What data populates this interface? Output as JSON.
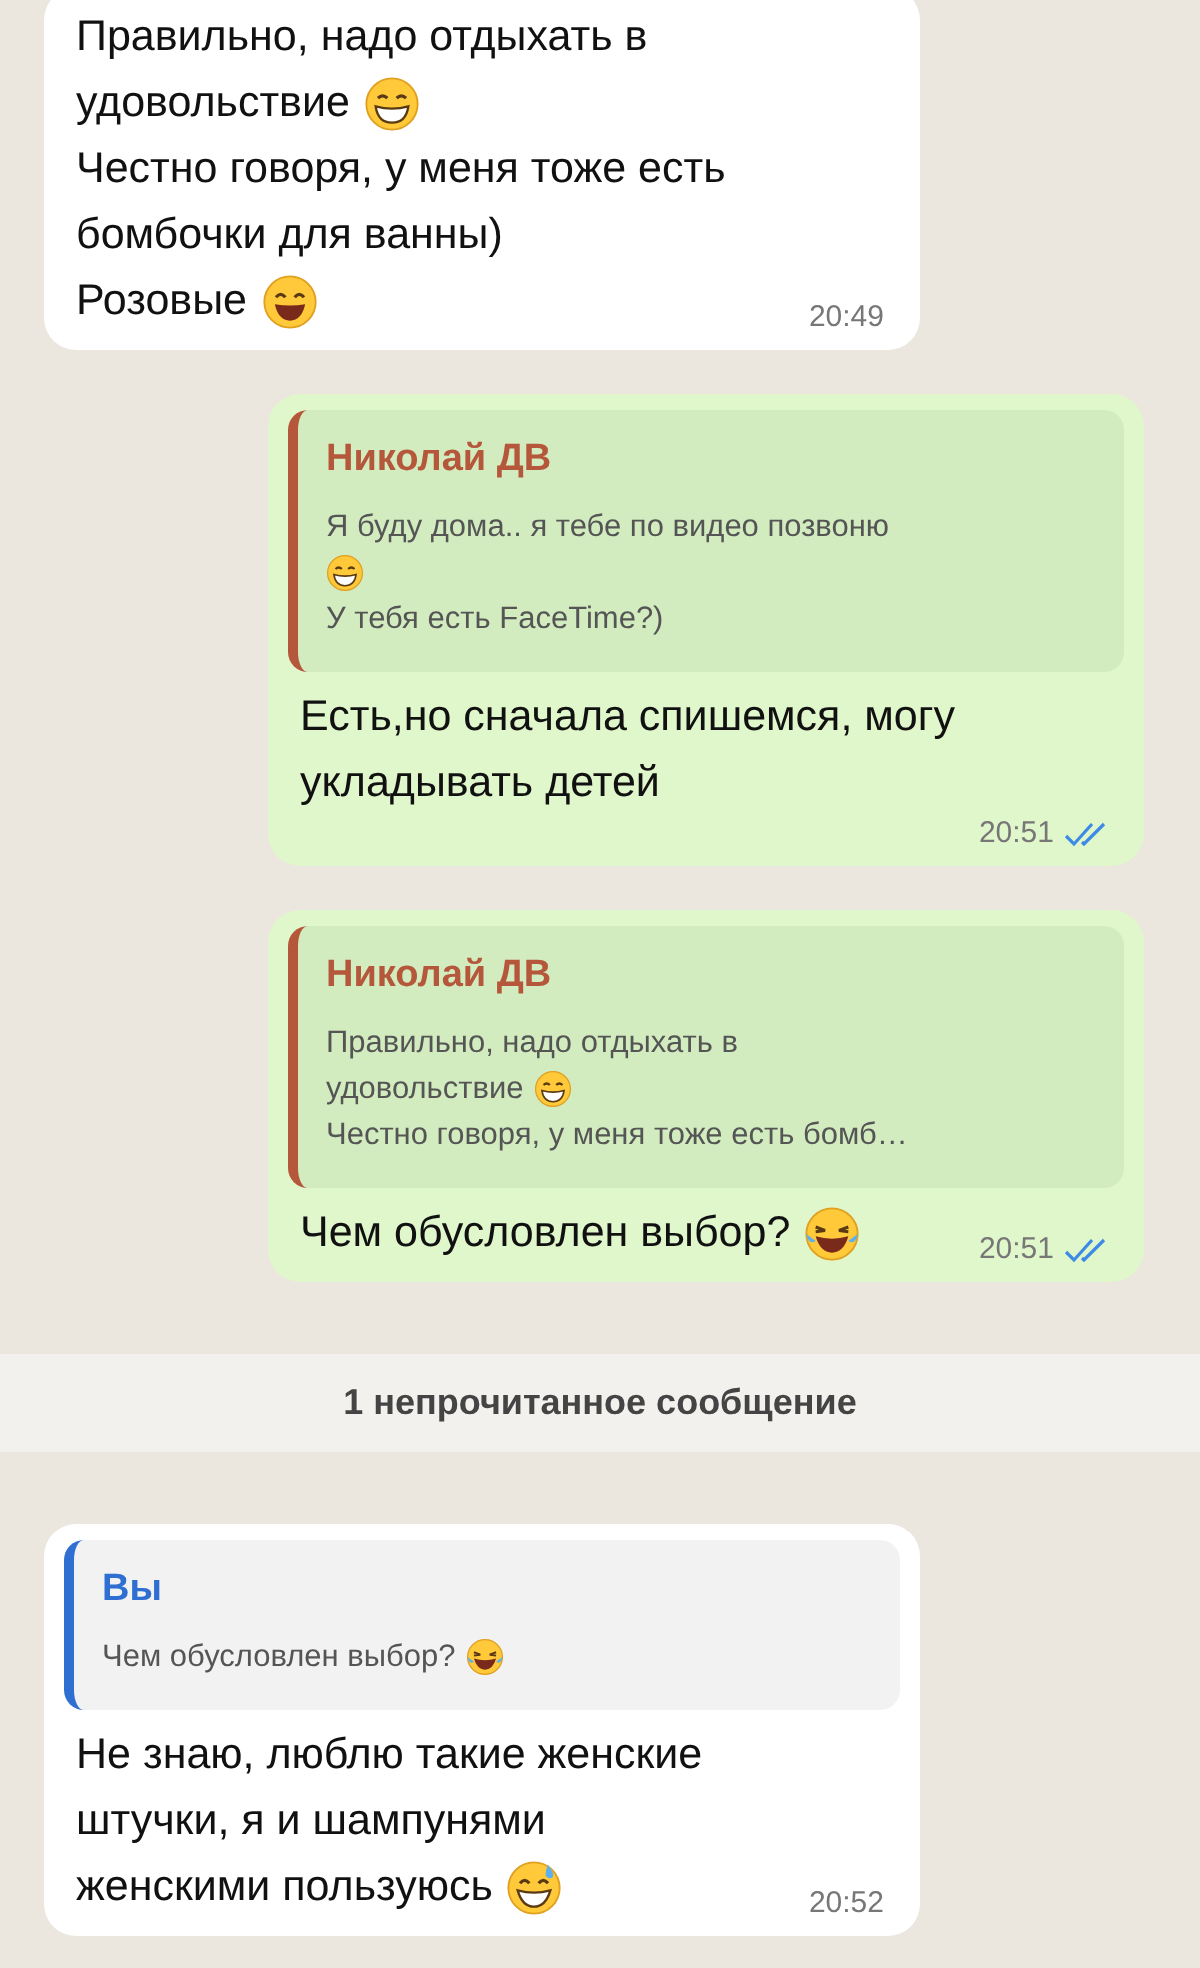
{
  "messages": [
    {
      "kind": "incoming",
      "lines": [
        {
          "kind": "plain",
          "text": "Правильно, надо отдыхать в"
        },
        {
          "kind": "grin",
          "text": "удовольствие"
        },
        {
          "kind": "plain",
          "text": "Честно говоря, у меня тоже есть"
        },
        {
          "kind": "plain",
          "text": "бомбочки для ванны)"
        },
        {
          "kind": "smile",
          "text": "Розовые"
        }
      ],
      "time": "20:49"
    },
    {
      "kind": "outgoing",
      "quote": {
        "author": "Николай ДВ",
        "color": "#b5573a",
        "lines": [
          {
            "kind": "plain",
            "text": "Я буду дома.. я тебе по видео позвоню"
          },
          {
            "kind": "grin"
          },
          {
            "kind": "plain",
            "text": "У тебя есть FaceTime?)"
          }
        ]
      },
      "lines": [
        {
          "kind": "plain",
          "text": "Есть,но сначала спишемся, могу"
        },
        {
          "kind": "plain",
          "text": "укладывать детей"
        }
      ],
      "time": "20:51",
      "read": true
    },
    {
      "kind": "outgoing",
      "quote": {
        "author": "Николай ДВ",
        "color": "#b5573a",
        "lines": [
          {
            "kind": "plain",
            "text": "Правильно, надо отдыхать в"
          },
          {
            "kind": "grin",
            "text": "удовольствие"
          },
          {
            "kind": "plain",
            "text": "Честно говоря, у меня тоже есть бомб…"
          }
        ]
      },
      "lines": [
        {
          "kind": "joy",
          "text": "Чем обусловлен выбор?"
        }
      ],
      "time": "20:51",
      "read": true
    },
    {
      "kind": "divider",
      "text": "1 непрочитанное сообщение"
    },
    {
      "kind": "incoming",
      "quote": {
        "author": "Вы",
        "color": "#2f6fd1",
        "lines": [
          {
            "kind": "joy",
            "text": "Чем обусловлен выбор?"
          }
        ]
      },
      "lines": [
        {
          "kind": "plain",
          "text": "Не знаю, люблю такие женские"
        },
        {
          "kind": "plain",
          "text": "штучки, я и шампунями"
        },
        {
          "kind": "sweat",
          "text": "женскими пользуюсь"
        }
      ],
      "time": "20:52"
    }
  ]
}
